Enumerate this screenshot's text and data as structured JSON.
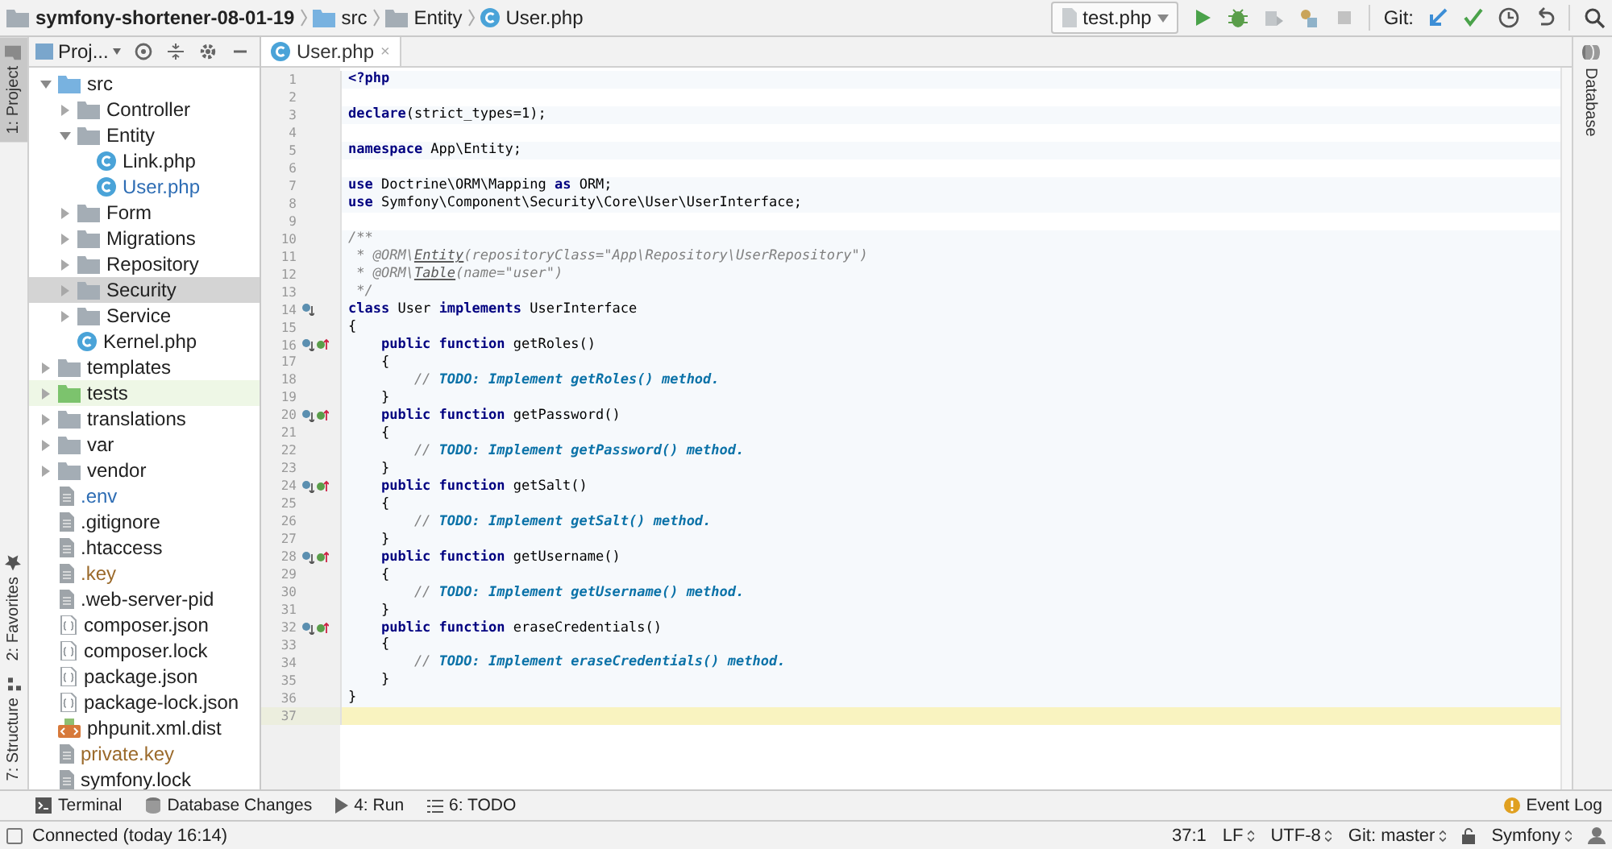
{
  "breadcrumbs": [
    {
      "label": "symfony-shortener-08-01-19",
      "kind": "folder"
    },
    {
      "label": "src",
      "kind": "source-folder"
    },
    {
      "label": "Entity",
      "kind": "folder"
    },
    {
      "label": "User.php",
      "kind": "php-class"
    }
  ],
  "run_config": {
    "label": "test.php"
  },
  "git": {
    "label": "Git:"
  },
  "left_strip": [
    {
      "label": "1: Project",
      "selected": true
    },
    {
      "label": "2: Favorites",
      "selected": false
    },
    {
      "label": "7: Structure",
      "selected": false
    }
  ],
  "project": {
    "title": "Proj...",
    "tree": [
      {
        "label": "src",
        "kind": "source-folder",
        "selected": false,
        "color": "#222222",
        "expanded": true,
        "children": [
          {
            "label": "Controller",
            "kind": "folder",
            "selected": false,
            "color": "#222222",
            "expanded": false
          },
          {
            "label": "Entity",
            "kind": "folder",
            "selected": false,
            "color": "#222222",
            "expanded": true,
            "children": [
              {
                "label": "Link.php",
                "kind": "php-class",
                "selected": false,
                "color": "#222222"
              },
              {
                "label": "User.php",
                "kind": "php-class",
                "selected": false,
                "color": "#2e6db4"
              }
            ]
          },
          {
            "label": "Form",
            "kind": "folder",
            "selected": false,
            "color": "#222222",
            "expanded": false
          },
          {
            "label": "Migrations",
            "kind": "folder",
            "selected": false,
            "color": "#222222",
            "expanded": false
          },
          {
            "label": "Repository",
            "kind": "folder",
            "selected": false,
            "color": "#222222",
            "expanded": false
          },
          {
            "label": "Security",
            "kind": "folder",
            "selected": true,
            "color": "#222222",
            "expanded": false
          },
          {
            "label": "Service",
            "kind": "folder",
            "selected": false,
            "color": "#222222",
            "expanded": false
          },
          {
            "label": "Kernel.php",
            "kind": "php-class",
            "selected": false,
            "color": "#222222"
          }
        ]
      },
      {
        "label": "templates",
        "kind": "folder",
        "selected": false,
        "color": "#222222",
        "expanded": false
      },
      {
        "label": "tests",
        "kind": "test-folder",
        "selected": false,
        "color": "#222222",
        "expanded": false
      },
      {
        "label": "translations",
        "kind": "folder",
        "selected": false,
        "color": "#222222",
        "expanded": false
      },
      {
        "label": "var",
        "kind": "folder",
        "selected": false,
        "color": "#222222",
        "expanded": false
      },
      {
        "label": "vendor",
        "kind": "folder",
        "selected": false,
        "color": "#222222",
        "expanded": false
      },
      {
        "label": ".env",
        "kind": "file",
        "selected": false,
        "color": "#2e6db4"
      },
      {
        "label": ".gitignore",
        "kind": "file",
        "selected": false,
        "color": "#222222"
      },
      {
        "label": ".htaccess",
        "kind": "file",
        "selected": false,
        "color": "#222222"
      },
      {
        "label": ".key",
        "kind": "file",
        "selected": false,
        "color": "#9b6a2b"
      },
      {
        "label": ".web-server-pid",
        "kind": "file",
        "selected": false,
        "color": "#222222"
      },
      {
        "label": "composer.json",
        "kind": "json",
        "selected": false,
        "color": "#222222"
      },
      {
        "label": "composer.lock",
        "kind": "json",
        "selected": false,
        "color": "#222222"
      },
      {
        "label": "package.json",
        "kind": "json",
        "selected": false,
        "color": "#222222"
      },
      {
        "label": "package-lock.json",
        "kind": "json",
        "selected": false,
        "color": "#222222"
      },
      {
        "label": "phpunit.xml.dist",
        "kind": "xml",
        "selected": false,
        "color": "#222222"
      },
      {
        "label": "private.key",
        "kind": "file",
        "selected": false,
        "color": "#9b6a2b"
      },
      {
        "label": "symfony.lock",
        "kind": "file",
        "selected": false,
        "color": "#222222"
      }
    ]
  },
  "editor": {
    "tabs": [
      {
        "label": "User.php",
        "close": "×",
        "selected": true
      }
    ],
    "lines": [
      {
        "n": "1",
        "current": false,
        "seg": [
          {
            "kind": "keyword",
            "text": "<?php"
          }
        ]
      },
      {
        "n": "2",
        "current": false
      },
      {
        "n": "3",
        "current": false,
        "seg": [
          {
            "kind": "keyword",
            "text": "declare"
          },
          {
            "kind": "plain",
            "text": "(strict_types=1);"
          }
        ]
      },
      {
        "n": "4",
        "current": false
      },
      {
        "n": "5",
        "current": false,
        "seg": [
          {
            "kind": "keyword",
            "text": "namespace"
          },
          {
            "kind": "plain",
            "text": " App\\Entity;"
          }
        ]
      },
      {
        "n": "6",
        "current": false
      },
      {
        "n": "7",
        "current": false,
        "seg": [
          {
            "kind": "keyword",
            "text": "use"
          },
          {
            "kind": "plain",
            "text": " Doctrine\\ORM\\Mapping "
          },
          {
            "kind": "keyword",
            "text": "as"
          },
          {
            "kind": "plain",
            "text": " ORM;"
          }
        ]
      },
      {
        "n": "8",
        "current": false,
        "seg": [
          {
            "kind": "keyword",
            "text": "use"
          },
          {
            "kind": "plain",
            "text": " Symfony\\Component\\Security\\Core\\User\\UserInterface;"
          }
        ]
      },
      {
        "n": "9",
        "current": false
      },
      {
        "n": "10",
        "current": false,
        "seg": [
          {
            "kind": "comment",
            "text": "/**"
          }
        ]
      },
      {
        "n": "11",
        "current": false,
        "seg": [
          {
            "kind": "comment",
            "text": " * @ORM\\"
          },
          {
            "kind": "doctag",
            "text": "Entity"
          },
          {
            "kind": "comment",
            "text": "(repositoryClass=\"App\\Repository\\UserRepository\")"
          }
        ]
      },
      {
        "n": "12",
        "current": false,
        "seg": [
          {
            "kind": "comment",
            "text": " * @ORM\\"
          },
          {
            "kind": "doctag",
            "text": "Table"
          },
          {
            "kind": "comment",
            "text": "(name=\"user\")"
          }
        ]
      },
      {
        "n": "13",
        "current": false,
        "seg": [
          {
            "kind": "comment",
            "text": " */"
          }
        ]
      },
      {
        "n": "14",
        "current": false,
        "kind": "class",
        "seg": [
          {
            "kind": "keyword",
            "text": "class"
          },
          {
            "kind": "plain",
            "text": " User "
          },
          {
            "kind": "keyword",
            "text": "implements"
          },
          {
            "kind": "plain",
            "text": " UserInterface"
          }
        ]
      },
      {
        "n": "15",
        "current": false,
        "seg": [
          {
            "kind": "plain",
            "text": "{"
          }
        ]
      },
      {
        "n": "16",
        "current": false,
        "kind": "method",
        "seg": [
          {
            "kind": "keyword",
            "text": "    public function"
          },
          {
            "kind": "plain",
            "text": " getRoles()"
          }
        ]
      },
      {
        "n": "17",
        "current": false,
        "seg": [
          {
            "kind": "plain",
            "text": "    {"
          }
        ]
      },
      {
        "n": "18",
        "current": false,
        "seg": [
          {
            "kind": "comment",
            "text": "        // "
          },
          {
            "kind": "todo",
            "text": "TODO: Implement getRoles() method."
          }
        ]
      },
      {
        "n": "19",
        "current": false,
        "seg": [
          {
            "kind": "plain",
            "text": "    }"
          }
        ]
      },
      {
        "n": "20",
        "current": false,
        "kind": "method",
        "seg": [
          {
            "kind": "keyword",
            "text": "    public function"
          },
          {
            "kind": "plain",
            "text": " getPassword()"
          }
        ]
      },
      {
        "n": "21",
        "current": false,
        "seg": [
          {
            "kind": "plain",
            "text": "    {"
          }
        ]
      },
      {
        "n": "22",
        "current": false,
        "seg": [
          {
            "kind": "comment",
            "text": "        // "
          },
          {
            "kind": "todo",
            "text": "TODO: Implement getPassword() method."
          }
        ]
      },
      {
        "n": "23",
        "current": false,
        "seg": [
          {
            "kind": "plain",
            "text": "    }"
          }
        ]
      },
      {
        "n": "24",
        "current": false,
        "kind": "method",
        "seg": [
          {
            "kind": "keyword",
            "text": "    public function"
          },
          {
            "kind": "plain",
            "text": " getSalt()"
          }
        ]
      },
      {
        "n": "25",
        "current": false,
        "seg": [
          {
            "kind": "plain",
            "text": "    {"
          }
        ]
      },
      {
        "n": "26",
        "current": false,
        "seg": [
          {
            "kind": "comment",
            "text": "        // "
          },
          {
            "kind": "todo",
            "text": "TODO: Implement getSalt() method."
          }
        ]
      },
      {
        "n": "27",
        "current": false,
        "seg": [
          {
            "kind": "plain",
            "text": "    }"
          }
        ]
      },
      {
        "n": "28",
        "current": false,
        "kind": "method",
        "seg": [
          {
            "kind": "keyword",
            "text": "    public function"
          },
          {
            "kind": "plain",
            "text": " getUsername()"
          }
        ]
      },
      {
        "n": "29",
        "current": false,
        "seg": [
          {
            "kind": "plain",
            "text": "    {"
          }
        ]
      },
      {
        "n": "30",
        "current": false,
        "seg": [
          {
            "kind": "comment",
            "text": "        // "
          },
          {
            "kind": "todo",
            "text": "TODO: Implement getUsername() method."
          }
        ]
      },
      {
        "n": "31",
        "current": false,
        "seg": [
          {
            "kind": "plain",
            "text": "    }"
          }
        ]
      },
      {
        "n": "32",
        "current": false,
        "kind": "method",
        "seg": [
          {
            "kind": "keyword",
            "text": "    public function"
          },
          {
            "kind": "plain",
            "text": " eraseCredentials()"
          }
        ]
      },
      {
        "n": "33",
        "current": false,
        "seg": [
          {
            "kind": "plain",
            "text": "    {"
          }
        ]
      },
      {
        "n": "34",
        "current": false,
        "seg": [
          {
            "kind": "comment",
            "text": "        // "
          },
          {
            "kind": "todo",
            "text": "TODO: Implement eraseCredentials() method."
          }
        ]
      },
      {
        "n": "35",
        "current": false,
        "seg": [
          {
            "kind": "plain",
            "text": "    }"
          }
        ]
      },
      {
        "n": "36",
        "current": false,
        "seg": [
          {
            "kind": "plain",
            "text": "}"
          }
        ]
      },
      {
        "n": "37",
        "current": true
      }
    ]
  },
  "right_strip": [
    {
      "label": "Database"
    }
  ],
  "tool_windows": [
    {
      "label": "Terminal",
      "kind": "terminal"
    },
    {
      "label": "Database Changes",
      "kind": "database"
    },
    {
      "label": "4: Run",
      "kind": "run"
    },
    {
      "label": "6: TODO",
      "kind": "todo"
    }
  ],
  "event_log": {
    "label": "Event Log"
  },
  "status_bar": {
    "message": "Connected (today 16:14)",
    "position": "37:1",
    "line_separator": "LF",
    "encoding": "UTF-8",
    "vcs": "Git: master",
    "framework": "Symfony"
  }
}
